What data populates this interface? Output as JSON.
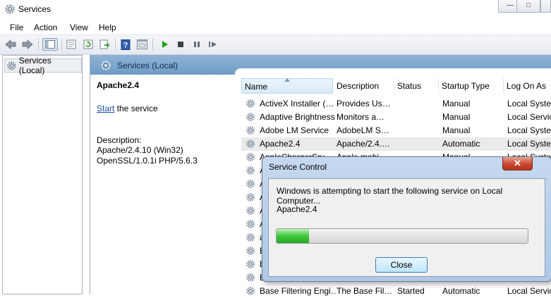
{
  "window": {
    "title": "Services",
    "minimize_glyph": "—",
    "maximize_glyph": "□",
    "icon": "gear-icon"
  },
  "menu": [
    "File",
    "Action",
    "View",
    "Help"
  ],
  "toolbar": {
    "buttons": [
      "back-arrow-icon",
      "forward-arrow-icon",
      "show-tree-icon",
      "properties-icon",
      "refresh-icon",
      "export-list-icon",
      "help-icon",
      "console-icon",
      "play-icon",
      "stop-icon",
      "pause-icon",
      "restart-icon"
    ]
  },
  "tree": {
    "root_label": "Services (Local)"
  },
  "pane": {
    "title": "Services (Local)",
    "service_name": "Apache2.4",
    "start_link": "Start",
    "start_suffix": " the service",
    "description_label": "Description:",
    "description_line1": "Apache/2.4.10 (Win32)",
    "description_line2": "OpenSSL/1.0.1i PHP/5.6.3"
  },
  "table": {
    "columns": [
      "Name",
      "Description",
      "Status",
      "Startup Type",
      "Log On As"
    ],
    "rows": [
      [
        "ActiveX Installer (…",
        "Provides Us…",
        "",
        "Manual",
        "Local Syste…"
      ],
      [
        "Adaptive Brightness",
        "Monitors a…",
        "",
        "Manual",
        "Local Servic…"
      ],
      [
        "Adobe LM Service",
        "AdobeLM S…",
        "",
        "Manual",
        "Local Syste…"
      ],
      [
        "Apache2.4",
        "Apache/2.4.…",
        "",
        "Automatic",
        "Local Syste…"
      ],
      [
        "AppleChargerSrv",
        "Apple mobi…",
        "",
        "Manual",
        "Local Syste…"
      ],
      [
        "A",
        "",
        "",
        "",
        "Local Syste…"
      ],
      [
        "A",
        "",
        "",
        "",
        "Local Servic…"
      ],
      [
        "A",
        "",
        "",
        "",
        "Local Syste…"
      ],
      [
        "A",
        "",
        "",
        "",
        "Local Syste…"
      ],
      [
        "A",
        "",
        "",
        "",
        "Local S…"
      ],
      [
        "a",
        "",
        "",
        "",
        "Local Syste…"
      ],
      [
        "B",
        "",
        "",
        "",
        "Local Servic…"
      ],
      [
        "B",
        "",
        "",
        "",
        "Local Syste…"
      ],
      [
        "B",
        "",
        "",
        "",
        "Local Servic…"
      ],
      [
        "Base Filtering Engi…",
        "The Base Fil…",
        "Started",
        "Automatic",
        "Local Servic…"
      ]
    ],
    "selected_row": 3
  },
  "dialog": {
    "title": "Service Control",
    "close_glyph": "✕",
    "message": "Windows is attempting to start the following service on Local Computer...",
    "service": "Apache2.4",
    "progress": 0.13,
    "close_button": "Close"
  },
  "colors": {
    "pane_header": "#7ea7cd",
    "selection": "#eaeaea",
    "progress_fill": "#3dc63a",
    "link": "#1a4ea0"
  }
}
